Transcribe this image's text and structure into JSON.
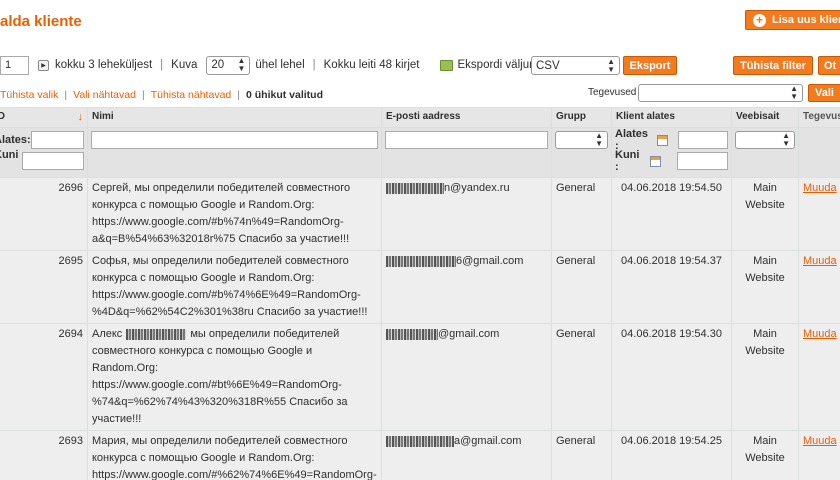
{
  "page": {
    "title": "alda kliente",
    "add_button": "Lisa uus klient"
  },
  "pager": {
    "page_value": "1",
    "total_pages_text": "kokku 3 leheküljest",
    "sep": "|",
    "view_label": "Kuva",
    "per_page": "20",
    "per_page_suffix": "ühel lehel",
    "total_records": "Kokku leiti 48 kirjet",
    "export_label": "Ekspordi väljund:",
    "export_format": "CSV",
    "export_button": "Eksport",
    "reset_filter_button": "Tühista filter",
    "search_button_partial": "Ot"
  },
  "massaction": {
    "unselect_all": "Tühista valik",
    "select_visible": "Vali nähtavad",
    "unselect_visible": "Tühista nähtavad",
    "selected_count": "0 ühikut valitud",
    "actions_label": "Tegevused",
    "submit_partial": "Vali"
  },
  "columns": {
    "id": "ID",
    "name": "Nimi",
    "email": "E-posti aadress",
    "group": "Grupp",
    "since": "Klient alates",
    "website": "Veebisait",
    "action": "Tegevus"
  },
  "filters": {
    "from": "Alates:",
    "to": "Kuni :",
    "from_date": "Alates :",
    "to_date": "Kuni :"
  },
  "rows": [
    {
      "id": "2696",
      "name": "Сергей, мы определили победителей совместного конкурса с помощью Google и Random.Org: https://www.google.com/#b%74n%49=RandomOrg-a&q=B%54%63%32018r%75 Спасибо за участие!!!",
      "email_visible": "n@yandex.ru",
      "group": "General",
      "since": "04.06.2018 19:54.50",
      "website": "Main Website",
      "action": "Muuda"
    },
    {
      "id": "2695",
      "name": "Софья, мы определили победителей совместного конкурса с помощью Google и Random.Org: https://www.google.com/#b%74%6E%49=RandomOrg-%4D&q=%62%54C2%301%38ru Спасибо за участие!!!",
      "email_visible": "6@gmail.com",
      "group": "General",
      "since": "04.06.2018 19:54.37",
      "website": "Main Website",
      "action": "Muuda"
    },
    {
      "id": "2694",
      "name_prefix": "Алекс",
      "name_suffix": "мы определили победителей совместного конкурса с помощью Google и Random.Org: https://www.google.com/#bt%6E%49=RandomOrg-%74&q=%62%74%43%320%318R%55 Спасибо за участие!!!",
      "email_visible": "@gmail.com",
      "group": "General",
      "since": "04.06.2018 19:54.30",
      "website": "Main Website",
      "action": "Muuda"
    },
    {
      "id": "2693",
      "name": "Мария, мы определили победителей совместного конкурса с помощью Google и Random.Org: https://www.google.com/#%62%74%6E%49=RandomOrg-",
      "email_visible": "a@gmail.com",
      "group": "General",
      "since": "04.06.2018 19:54.25",
      "website": "Main Website",
      "action": "Muuda"
    }
  ],
  "colors": {
    "accent": "#eb5e00",
    "button": "#f37a1f",
    "row_bg": "#eeeeee",
    "header_bg": "#e6e6e6"
  }
}
